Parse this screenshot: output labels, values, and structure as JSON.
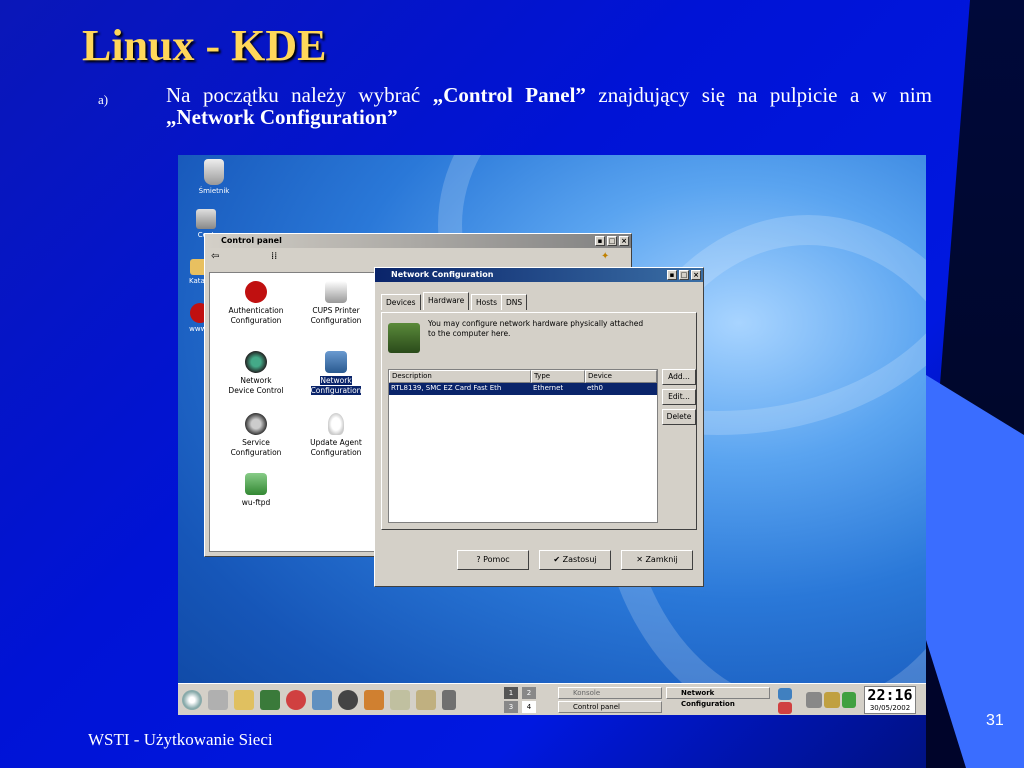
{
  "slide": {
    "title": "Linux - KDE",
    "bullet_marker": "a)",
    "bullet_part1": "Na początku należy wybrać ",
    "bullet_bold1": "„Control Panel”",
    "bullet_part2": " znajdujący się na pulpicie a w nim ",
    "bullet_bold2": "„Network Configuration”",
    "footer": "WSTI - Użytkowanie Sieci",
    "page_number": "31"
  },
  "desktop": {
    "icons": [
      {
        "label": "Śmietnik",
        "icon": "trash-icon"
      },
      {
        "label": "Cent",
        "icon": "desktop-app-icon"
      },
      {
        "label": "Katalo",
        "icon": "folder-icon"
      },
      {
        "label": "www.r",
        "icon": "redhat-icon"
      }
    ]
  },
  "control_panel": {
    "title": "Control panel",
    "items": [
      {
        "label1": "Authentication",
        "label2": "Configuration",
        "icon": "redhat-icon"
      },
      {
        "label1": "CUPS Printer",
        "label2": "Configuration",
        "icon": "printer-icon"
      },
      {
        "label1": "Network",
        "label2": "Device Control",
        "icon": "network-device-icon"
      },
      {
        "label1": "Network",
        "label2": "Configuration",
        "icon": "network-config-icon"
      },
      {
        "label1": "Service",
        "label2": "Configuration",
        "icon": "gear-icon"
      },
      {
        "label1": "Update Agent",
        "label2": "Configuration",
        "icon": "lightbulb-icon"
      },
      {
        "label1": "wu-ftpd",
        "label2": "",
        "icon": "ftp-icon"
      }
    ]
  },
  "network_config": {
    "title": "Network Configuration",
    "tabs": [
      "Devices",
      "Hardware",
      "Hosts",
      "DNS"
    ],
    "active_tab": "Hardware",
    "info_text": "You may configure network hardware physically attached to the computer here.",
    "columns": [
      "Description",
      "Type",
      "Device"
    ],
    "rows": [
      {
        "description": "RTL8139, SMC EZ Card Fast Eth",
        "type": "Ethernet",
        "device": "eth0"
      }
    ],
    "side_buttons": [
      "Add...",
      "Edit...",
      "Delete"
    ],
    "bottom_buttons": [
      "Pomoc",
      "Zastosuj",
      "Zamknij"
    ]
  },
  "taskbar": {
    "pager": [
      "1",
      "2",
      "3",
      "4"
    ],
    "tasks": [
      "Konsole",
      "Control panel",
      "Network Configuration"
    ],
    "time": "22:16",
    "date": "30/05/2002"
  }
}
